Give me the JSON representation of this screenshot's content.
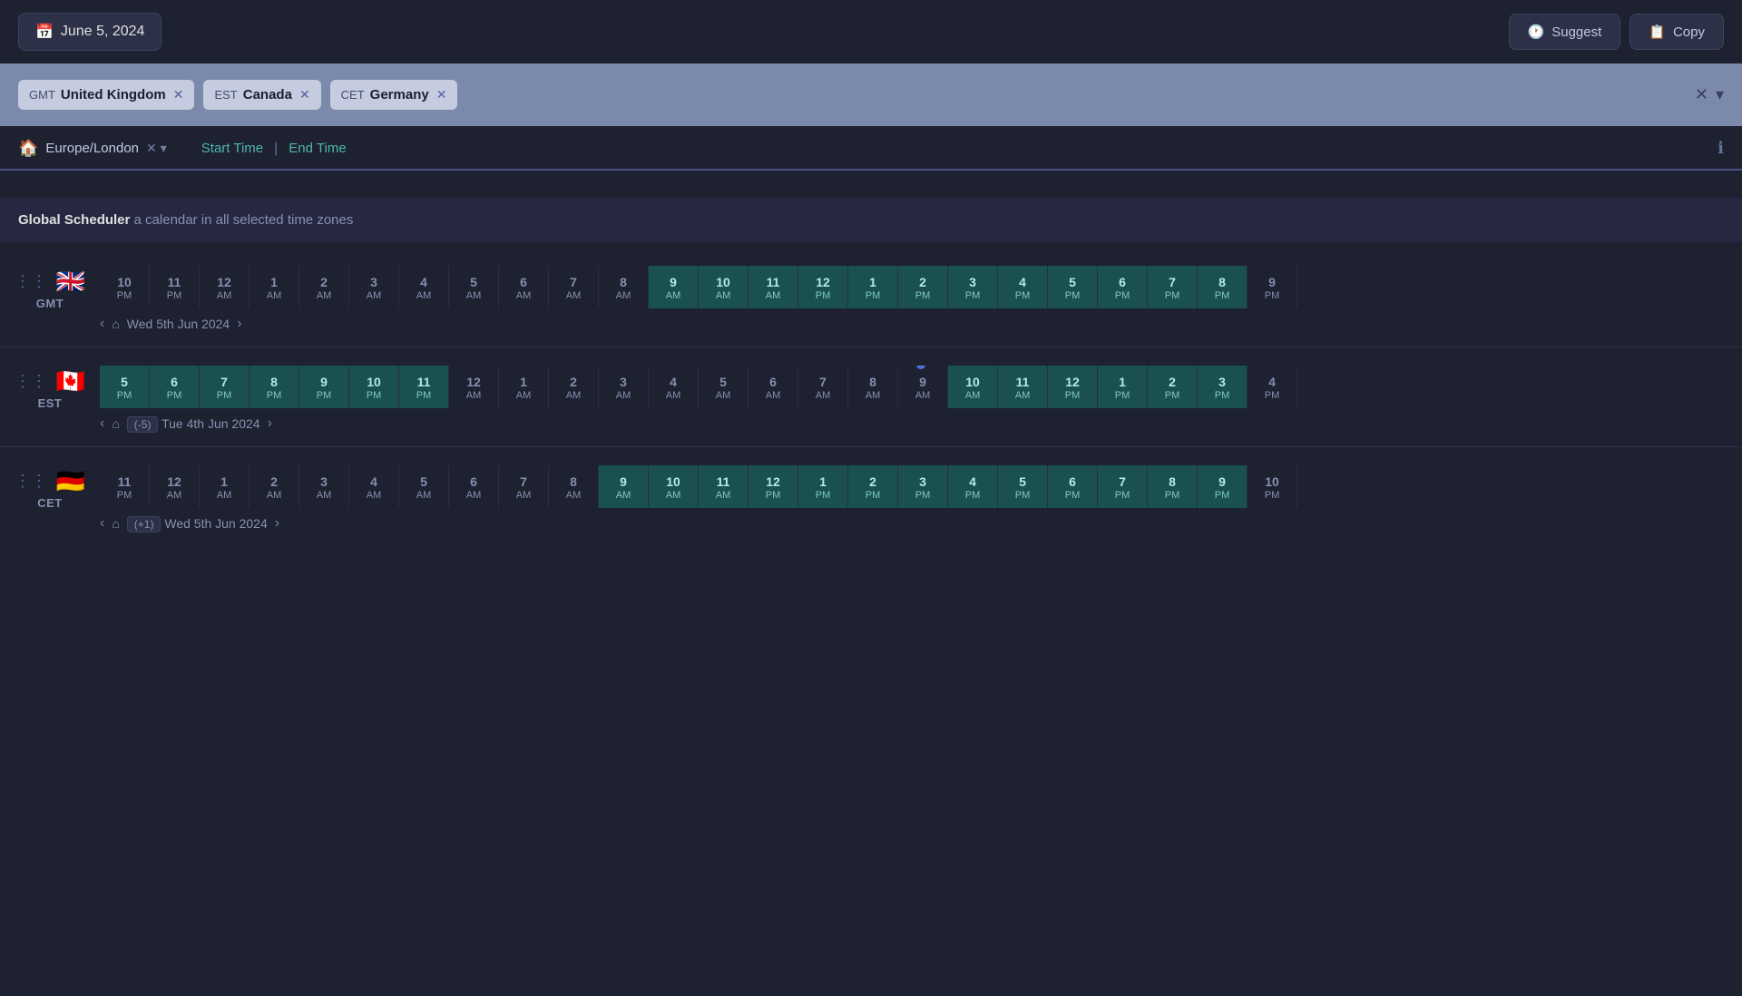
{
  "header": {
    "date_label": "June 5, 2024",
    "suggest_label": "Suggest",
    "copy_label": "Copy"
  },
  "tz_tags": [
    {
      "code": "GMT",
      "name": "United Kingdom"
    },
    {
      "code": "EST",
      "name": "Canada"
    },
    {
      "code": "CET",
      "name": "Germany"
    }
  ],
  "home_tz": "Europe/London",
  "start_time_label": "Start Time",
  "end_time_label": "End Time",
  "scheduler": {
    "title": "Global Scheduler",
    "subtitle": "a calendar in all selected time zones"
  },
  "rows": [
    {
      "flag": "🇬🇧",
      "abbr": "GMT",
      "offset_label": "",
      "date_label": "Wed 5th Jun 2024",
      "hours": [
        {
          "h": "10",
          "ap": "PM",
          "dark": true
        },
        {
          "h": "11",
          "ap": "PM",
          "dark": true
        },
        {
          "h": "12",
          "ap": "AM",
          "dark": false
        },
        {
          "h": "1",
          "ap": "AM",
          "dark": false
        },
        {
          "h": "2",
          "ap": "AM",
          "dark": false
        },
        {
          "h": "3",
          "ap": "AM",
          "dark": false
        },
        {
          "h": "4",
          "ap": "AM",
          "dark": false
        },
        {
          "h": "5",
          "ap": "AM",
          "dark": false
        },
        {
          "h": "6",
          "ap": "AM",
          "dark": false
        },
        {
          "h": "7",
          "ap": "AM",
          "dark": false
        },
        {
          "h": "8",
          "ap": "AM",
          "dark": false
        },
        {
          "h": "9",
          "ap": "AM",
          "teal": true
        },
        {
          "h": "10",
          "ap": "AM",
          "teal": true
        },
        {
          "h": "11",
          "ap": "AM",
          "teal": true
        },
        {
          "h": "12",
          "ap": "PM",
          "teal": true
        },
        {
          "h": "1",
          "ap": "PM",
          "teal": true
        },
        {
          "h": "2",
          "ap": "PM",
          "teal": true
        },
        {
          "h": "3",
          "ap": "PM",
          "teal": true
        },
        {
          "h": "4",
          "ap": "PM",
          "teal": true
        },
        {
          "h": "5",
          "ap": "PM",
          "teal": true
        },
        {
          "h": "6",
          "ap": "PM",
          "teal": true
        },
        {
          "h": "7",
          "ap": "PM",
          "teal": true
        },
        {
          "h": "8",
          "ap": "PM",
          "teal": true
        },
        {
          "h": "9",
          "ap": "PM",
          "dark": false
        }
      ]
    },
    {
      "flag": "🇨🇦",
      "abbr": "EST",
      "offset_label": "(-5)",
      "date_label": "Tue 4th Jun 2024",
      "hours": [
        {
          "h": "5",
          "ap": "PM",
          "teal": true
        },
        {
          "h": "6",
          "ap": "PM",
          "teal": true
        },
        {
          "h": "7",
          "ap": "PM",
          "teal": true
        },
        {
          "h": "8",
          "ap": "PM",
          "teal": true
        },
        {
          "h": "9",
          "ap": "PM",
          "teal": true
        },
        {
          "h": "10",
          "ap": "PM",
          "teal": true
        },
        {
          "h": "11",
          "ap": "PM",
          "teal": true
        },
        {
          "h": "12",
          "ap": "AM",
          "dark": false
        },
        {
          "h": "1",
          "ap": "AM",
          "dark": false
        },
        {
          "h": "2",
          "ap": "AM",
          "dark": false
        },
        {
          "h": "3",
          "ap": "AM",
          "dark": false
        },
        {
          "h": "4",
          "ap": "AM",
          "dark": false
        },
        {
          "h": "5",
          "ap": "AM",
          "dark": false
        },
        {
          "h": "6",
          "ap": "AM",
          "dark": false
        },
        {
          "h": "7",
          "ap": "AM",
          "dark": false
        },
        {
          "h": "8",
          "ap": "AM",
          "dark": false
        },
        {
          "h": "9",
          "ap": "AM",
          "dark": false
        },
        {
          "h": "10",
          "ap": "AM",
          "teal": true
        },
        {
          "h": "11",
          "ap": "AM",
          "teal": true
        },
        {
          "h": "12",
          "ap": "PM",
          "teal": true
        },
        {
          "h": "1",
          "ap": "PM",
          "teal": true
        },
        {
          "h": "2",
          "ap": "PM",
          "teal": true
        },
        {
          "h": "3",
          "ap": "PM",
          "teal": true
        },
        {
          "h": "4",
          "ap": "PM",
          "dark": false
        }
      ]
    },
    {
      "flag": "🇩🇪",
      "abbr": "CET",
      "offset_label": "(+1)",
      "date_label": "Wed 5th Jun 2024",
      "hours": [
        {
          "h": "11",
          "ap": "PM",
          "dark": true
        },
        {
          "h": "12",
          "ap": "AM",
          "dark": false
        },
        {
          "h": "1",
          "ap": "AM",
          "dark": false
        },
        {
          "h": "2",
          "ap": "AM",
          "dark": false
        },
        {
          "h": "3",
          "ap": "AM",
          "dark": false
        },
        {
          "h": "4",
          "ap": "AM",
          "dark": false
        },
        {
          "h": "5",
          "ap": "AM",
          "dark": false
        },
        {
          "h": "6",
          "ap": "AM",
          "dark": false
        },
        {
          "h": "7",
          "ap": "AM",
          "dark": false
        },
        {
          "h": "8",
          "ap": "AM",
          "dark": false
        },
        {
          "h": "9",
          "ap": "AM",
          "teal": true
        },
        {
          "h": "10",
          "ap": "AM",
          "teal": true
        },
        {
          "h": "11",
          "ap": "AM",
          "teal": true
        },
        {
          "h": "12",
          "ap": "PM",
          "teal": true
        },
        {
          "h": "1",
          "ap": "PM",
          "teal": true
        },
        {
          "h": "2",
          "ap": "PM",
          "teal": true
        },
        {
          "h": "3",
          "ap": "PM",
          "teal": true
        },
        {
          "h": "4",
          "ap": "PM",
          "teal": true
        },
        {
          "h": "5",
          "ap": "PM",
          "teal": true
        },
        {
          "h": "6",
          "ap": "PM",
          "teal": true
        },
        {
          "h": "7",
          "ap": "PM",
          "teal": true
        },
        {
          "h": "8",
          "ap": "PM",
          "teal": true
        },
        {
          "h": "9",
          "ap": "PM",
          "teal": true
        },
        {
          "h": "10",
          "ap": "PM",
          "dark": false
        }
      ]
    }
  ]
}
